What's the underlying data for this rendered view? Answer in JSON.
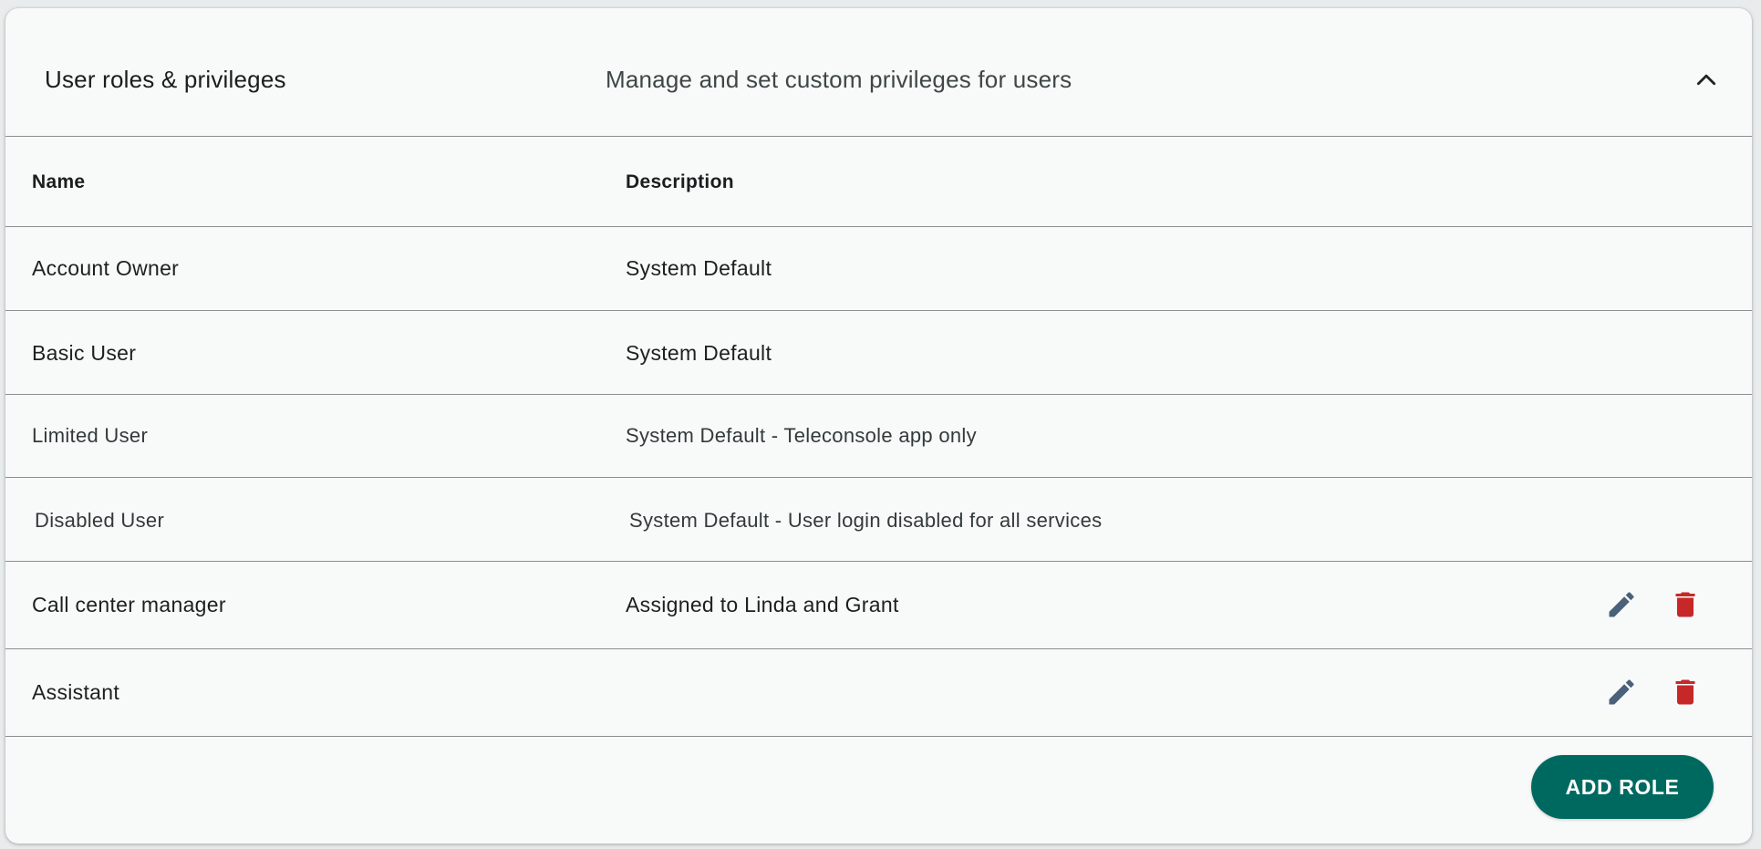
{
  "panel": {
    "title": "User roles & privileges",
    "subtitle": "Manage and set custom privileges for users",
    "collapse_icon": "chevron-up-icon"
  },
  "table": {
    "columns": [
      "Name",
      "Description"
    ],
    "rows": [
      {
        "name": "Account Owner",
        "description": "System Default",
        "editable": false
      },
      {
        "name": "Basic User",
        "description": "System Default",
        "editable": false
      },
      {
        "name": "Limited User",
        "description": "System Default - Teleconsole app only",
        "editable": false
      },
      {
        "name": "Disabled User",
        "description": "System Default - User login disabled for all services",
        "editable": false
      },
      {
        "name": "Call center manager",
        "description": "Assigned to Linda and Grant",
        "editable": true
      },
      {
        "name": "Assistant",
        "description": "",
        "editable": true
      }
    ]
  },
  "actions": {
    "edit_icon": "pencil-icon",
    "delete_icon": "trash-icon",
    "edit_color": "#4a6179",
    "delete_color": "#c62828"
  },
  "footer": {
    "add_role_label": "ADD ROLE",
    "add_role_color": "#00695f"
  }
}
